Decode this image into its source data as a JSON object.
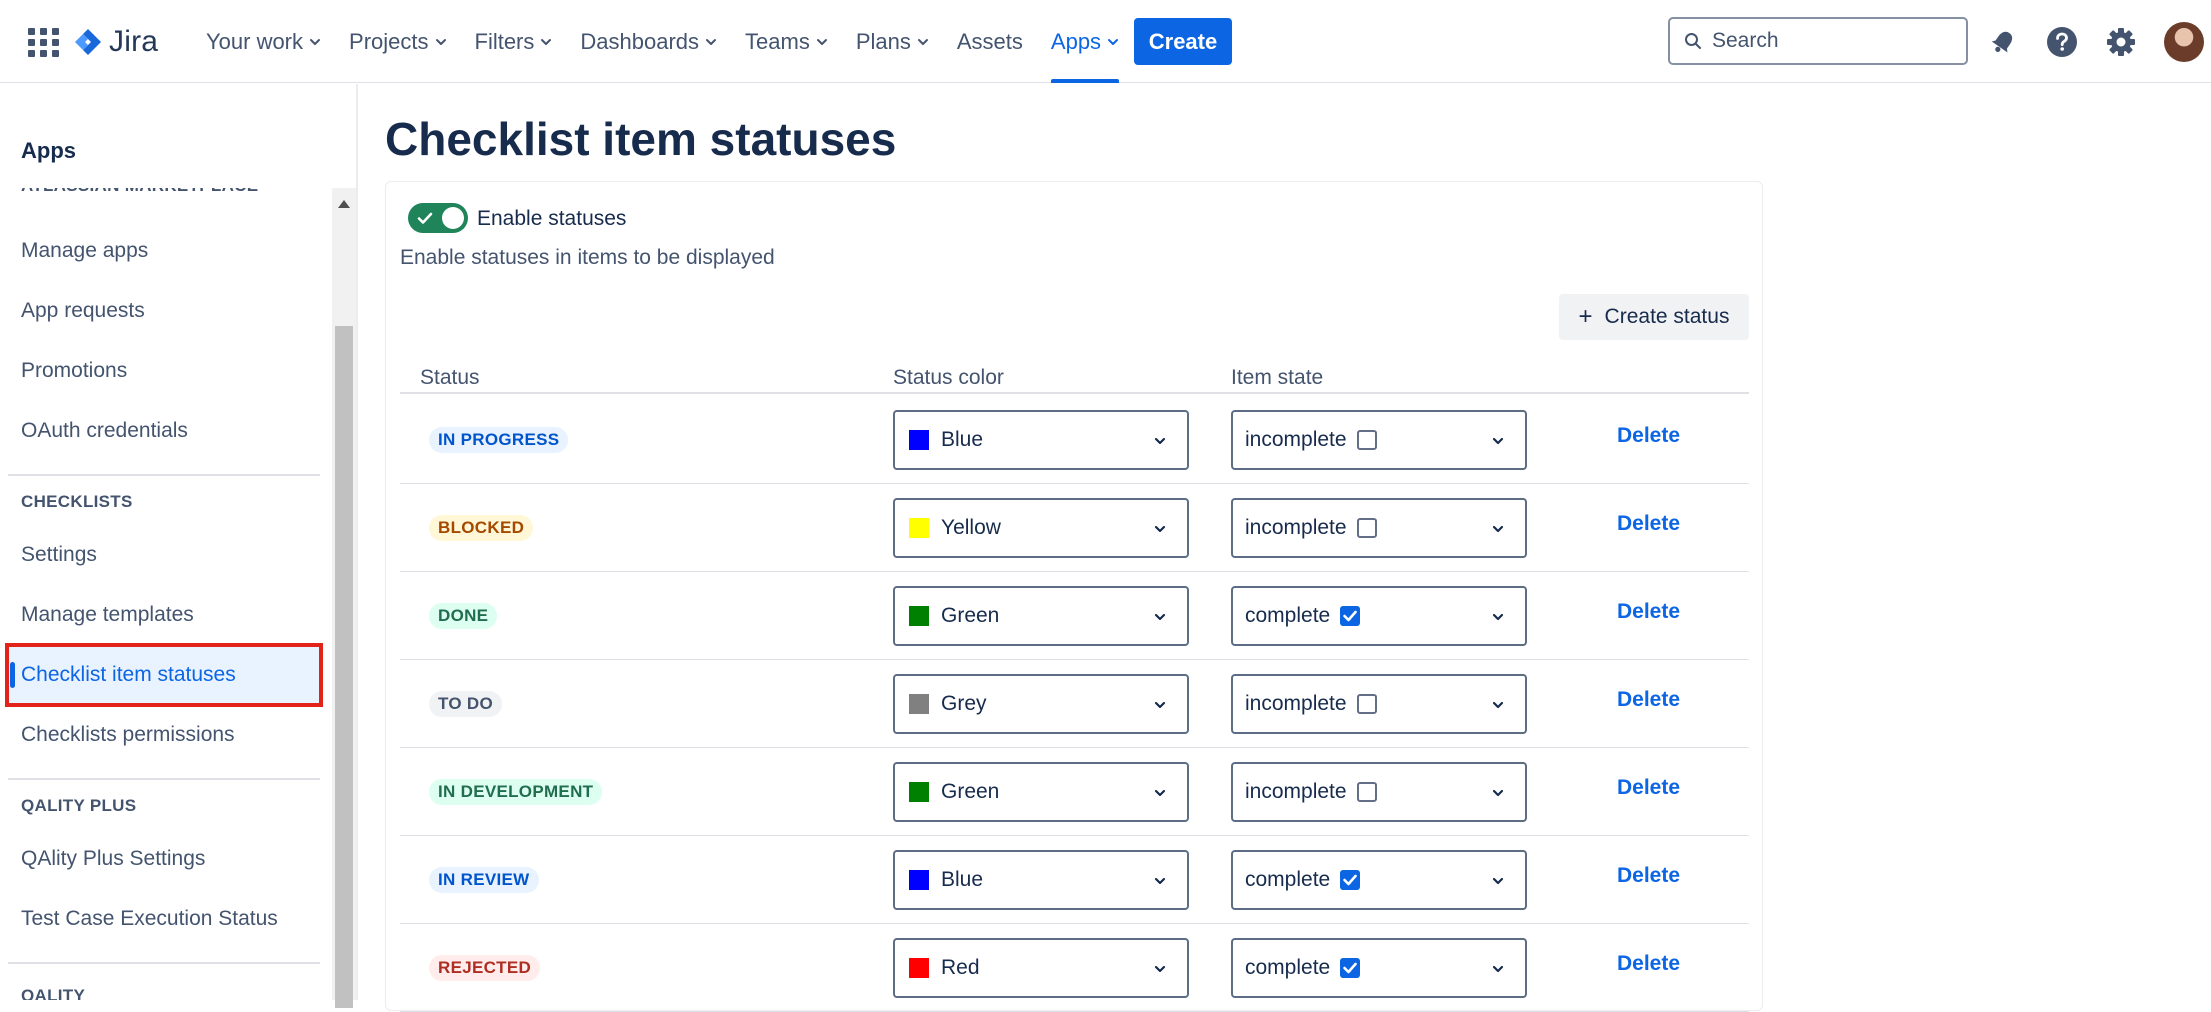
{
  "topbar": {
    "logo": "Jira",
    "nav": [
      {
        "label": "Your work",
        "dropdown": true
      },
      {
        "label": "Projects",
        "dropdown": true
      },
      {
        "label": "Filters",
        "dropdown": true
      },
      {
        "label": "Dashboards",
        "dropdown": true
      },
      {
        "label": "Teams",
        "dropdown": true
      },
      {
        "label": "Plans",
        "dropdown": true
      },
      {
        "label": "Assets",
        "dropdown": false
      },
      {
        "label": "Apps",
        "dropdown": true,
        "active": true
      }
    ],
    "create_label": "Create",
    "search_placeholder": "Search",
    "accent": "#0c66e4"
  },
  "sidebar": {
    "title": "Apps",
    "sections": [
      {
        "heading": "ATLASSIAN MARKETPLACE",
        "items": [
          "Manage apps",
          "App requests",
          "Promotions",
          "OAuth credentials"
        ]
      },
      {
        "heading": "CHECKLISTS",
        "items": [
          "Settings",
          "Manage templates",
          "Checklist item statuses",
          "Checklists permissions"
        ]
      },
      {
        "heading": "QALITY PLUS",
        "items": [
          "QAlity Plus Settings",
          "Test Case Execution Status"
        ]
      },
      {
        "heading": "QALITY",
        "items": []
      }
    ],
    "selected": "Checklist item statuses"
  },
  "main": {
    "title": "Checklist item statuses",
    "toggle_label": "Enable statuses",
    "toggle_on": true,
    "toggle_help": "Enable statuses in items to be displayed",
    "create_status_label": "Create status",
    "columns": [
      "Status",
      "Status color",
      "Item state"
    ],
    "delete_label": "Delete",
    "rows": [
      {
        "status": "IN PROGRESS",
        "lozenge_bg": "#e9f2ff",
        "lozenge_fg": "#0055cc",
        "color_name": "Blue",
        "swatch": "#0000ff",
        "state": "incomplete",
        "checked": false
      },
      {
        "status": "BLOCKED",
        "lozenge_bg": "#fff7d6",
        "lozenge_fg": "#a54800",
        "color_name": "Yellow",
        "swatch": "#ffff00",
        "state": "incomplete",
        "checked": false
      },
      {
        "status": "DONE",
        "lozenge_bg": "#dcfff1",
        "lozenge_fg": "#216e4e",
        "color_name": "Green",
        "swatch": "#008000",
        "state": "complete",
        "checked": true
      },
      {
        "status": "TO DO",
        "lozenge_bg": "#f1f2f4",
        "lozenge_fg": "#44546f",
        "color_name": "Grey",
        "swatch": "#808080",
        "state": "incomplete",
        "checked": false
      },
      {
        "status": "IN DEVELOPMENT",
        "lozenge_bg": "#dcfff1",
        "lozenge_fg": "#216e4e",
        "color_name": "Green",
        "swatch": "#008000",
        "state": "incomplete",
        "checked": false
      },
      {
        "status": "IN REVIEW",
        "lozenge_bg": "#e9f2ff",
        "lozenge_fg": "#0055cc",
        "color_name": "Blue",
        "swatch": "#0000ff",
        "state": "complete",
        "checked": true
      },
      {
        "status": "REJECTED",
        "lozenge_bg": "#ffeceb",
        "lozenge_fg": "#ae2e24",
        "color_name": "Red",
        "swatch": "#ff0000",
        "state": "complete",
        "checked": true
      }
    ]
  }
}
